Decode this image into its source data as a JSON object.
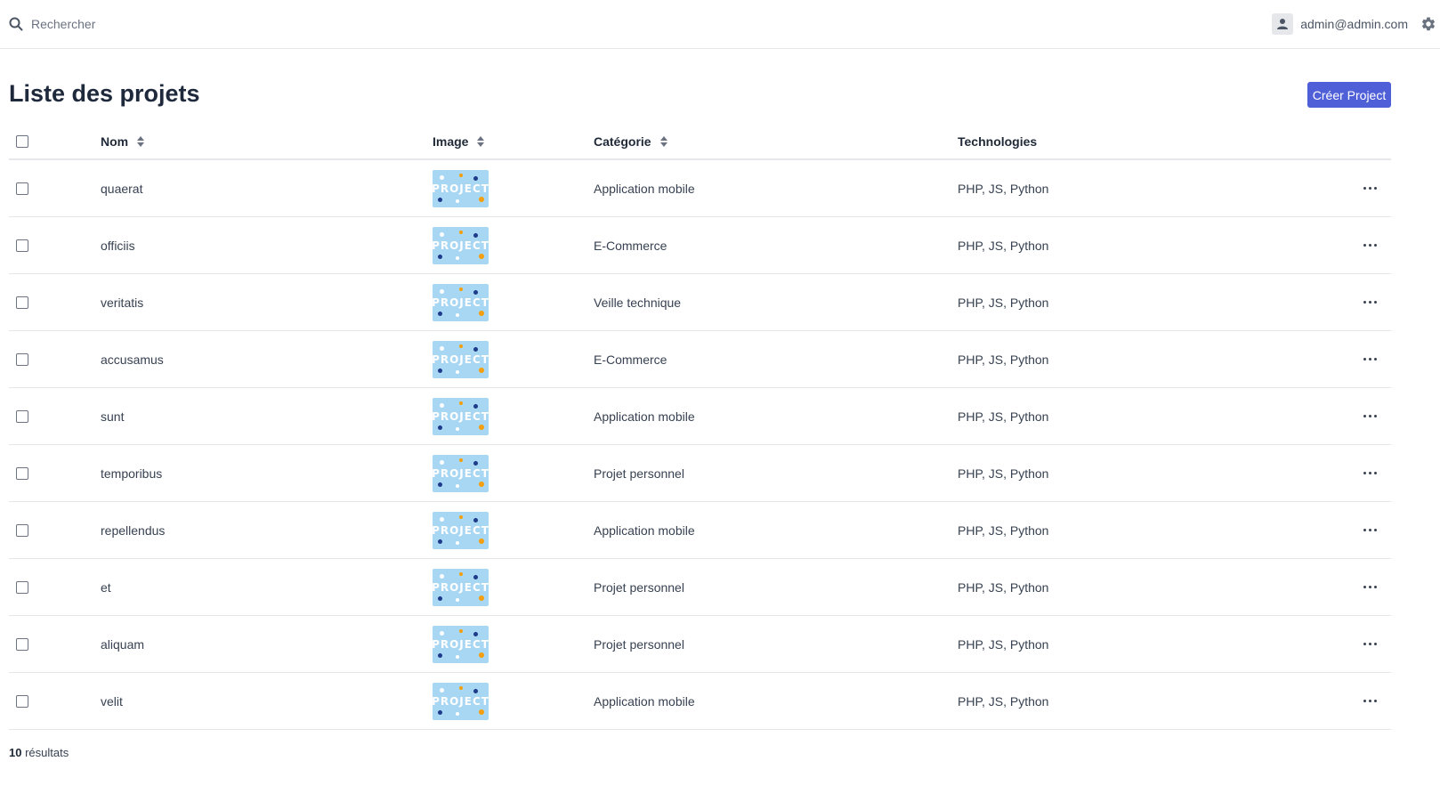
{
  "search": {
    "placeholder": "Rechercher"
  },
  "user": {
    "email": "admin@admin.com"
  },
  "page": {
    "title": "Liste des projets",
    "create_label": "Créer Project"
  },
  "table": {
    "columns": {
      "name": "Nom",
      "image": "Image",
      "category": "Catégorie",
      "technologies": "Technologies"
    },
    "rows": [
      {
        "name": "quaerat",
        "image_text": "PROJECT",
        "category": "Application mobile",
        "technologies": "PHP, JS, Python"
      },
      {
        "name": "officiis",
        "image_text": "PROJECT",
        "category": "E-Commerce",
        "technologies": "PHP, JS, Python"
      },
      {
        "name": "veritatis",
        "image_text": "PROJECT",
        "category": "Veille technique",
        "technologies": "PHP, JS, Python"
      },
      {
        "name": "accusamus",
        "image_text": "PROJECT",
        "category": "E-Commerce",
        "technologies": "PHP, JS, Python"
      },
      {
        "name": "sunt",
        "image_text": "PROJECT",
        "category": "Application mobile",
        "technologies": "PHP, JS, Python"
      },
      {
        "name": "temporibus",
        "image_text": "PROJECT",
        "category": "Projet personnel",
        "technologies": "PHP, JS, Python"
      },
      {
        "name": "repellendus",
        "image_text": "PROJECT",
        "category": "Application mobile",
        "technologies": "PHP, JS, Python"
      },
      {
        "name": "et",
        "image_text": "PROJECT",
        "category": "Projet personnel",
        "technologies": "PHP, JS, Python"
      },
      {
        "name": "aliquam",
        "image_text": "PROJECT",
        "category": "Projet personnel",
        "technologies": "PHP, JS, Python"
      },
      {
        "name": "velit",
        "image_text": "PROJECT",
        "category": "Application mobile",
        "technologies": "PHP, JS, Python"
      }
    ]
  },
  "footer": {
    "count": "10",
    "label": "résultats"
  },
  "icons": {
    "search": "search-icon",
    "user": "user-icon",
    "settings": "gear-icon",
    "sort": "sort-icon",
    "more": "more-icon"
  },
  "colors": {
    "accent": "#4f5fd8",
    "thumbnail": "#a8d7f3"
  }
}
